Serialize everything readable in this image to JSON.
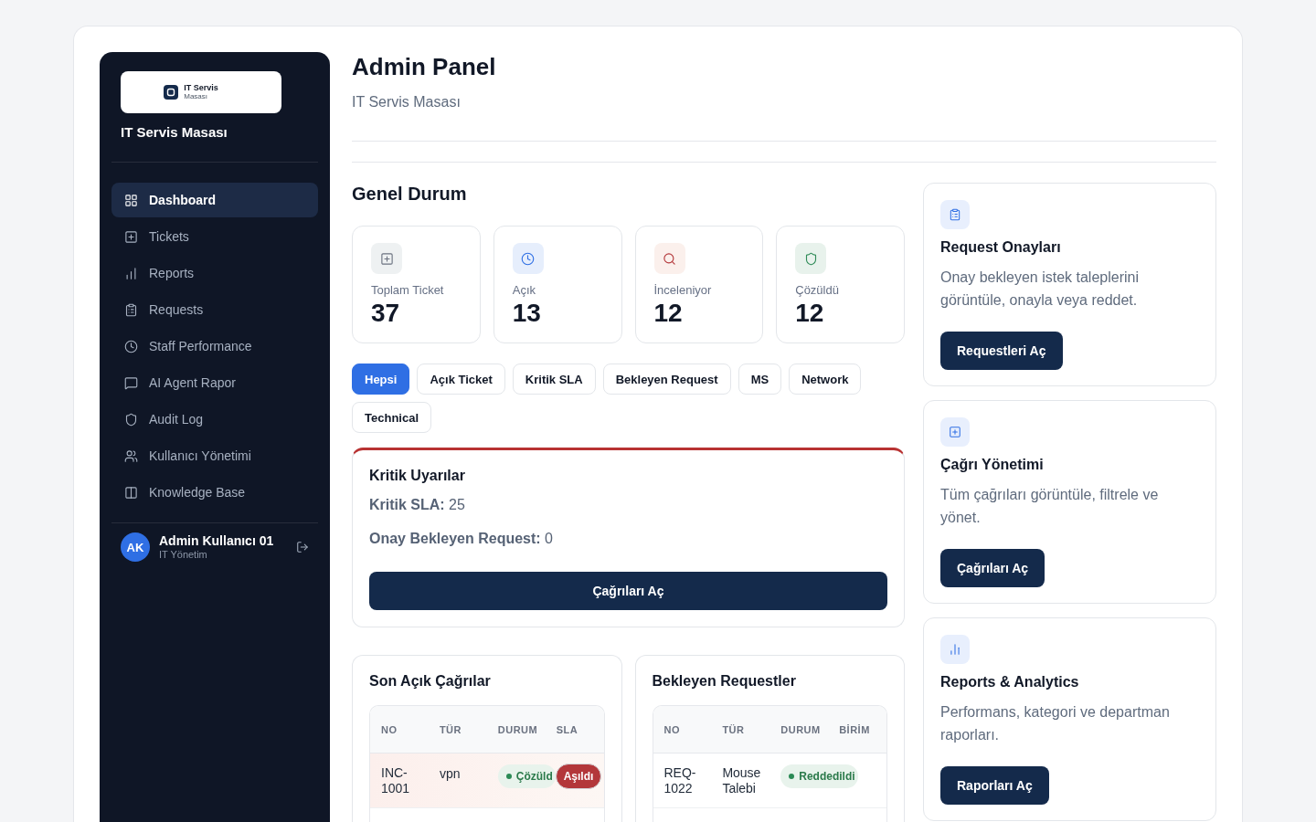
{
  "sidebar": {
    "logo": {
      "title": "IT Servis",
      "subtitle": "Masası"
    },
    "brand": "IT Servis Masası",
    "nav": [
      {
        "label": "Dashboard",
        "selected": true
      },
      {
        "label": "Tickets",
        "selected": false
      },
      {
        "label": "Reports",
        "selected": false
      },
      {
        "label": "Requests",
        "selected": false
      },
      {
        "label": "Staff Performance",
        "selected": false
      },
      {
        "label": "AI Agent Rapor",
        "selected": false
      },
      {
        "label": "Audit Log",
        "selected": false
      },
      {
        "label": "Kullanıcı Yönetimi",
        "selected": false
      },
      {
        "label": "Knowledge Base",
        "selected": false
      }
    ],
    "user": {
      "initials": "AK",
      "name": "Admin Kullanıcı 01",
      "role": "IT Yönetim"
    }
  },
  "header": {
    "title": "Admin Panel",
    "subtitle": "IT Servis Masası"
  },
  "overview": {
    "title": "Genel Durum",
    "stats": [
      {
        "kind": "total",
        "label": "Toplam Ticket",
        "value": "37"
      },
      {
        "kind": "open",
        "label": "Açık",
        "value": "13"
      },
      {
        "kind": "review",
        "label": "İnceleniyor",
        "value": "12"
      },
      {
        "kind": "resolved",
        "label": "Çözüldü",
        "value": "12"
      }
    ]
  },
  "filters": [
    {
      "label": "Hepsi",
      "selected": true
    },
    {
      "label": "Açık Ticket",
      "selected": false
    },
    {
      "label": "Kritik SLA",
      "selected": false
    },
    {
      "label": "Bekleyen Request",
      "selected": false
    },
    {
      "label": "MS",
      "selected": false
    },
    {
      "label": "Network",
      "selected": false
    },
    {
      "label": "Technical",
      "selected": false
    }
  ],
  "alerts": {
    "title": "Kritik Uyarılar",
    "lines": [
      "**Kritik SLA:** 25",
      "**Onay Bekleyen Request:** 0"
    ],
    "button": "Çağrıları Aç"
  },
  "recent_calls": {
    "title": "Son Açık Çağrılar",
    "columns": [
      "NO",
      "TÜR",
      "DURUM",
      "SLA"
    ],
    "rows": [
      {
        "highlighted": true,
        "cells": [
          {
            "kind": "text",
            "text": "INC-1001"
          },
          {
            "kind": "text",
            "text": "vpn"
          },
          {
            "kind": "status",
            "text": "Çözüld"
          },
          {
            "kind": "badge",
            "text": "Aşıldı"
          }
        ]
      }
    ]
  },
  "pending_requests": {
    "title": "Bekleyen Requestler",
    "columns": [
      "NO",
      "TÜR",
      "DURUM",
      "BİRİM"
    ],
    "rows": [
      {
        "highlighted": false,
        "cells": [
          {
            "kind": "text",
            "text": "REQ-1022"
          },
          {
            "kind": "text",
            "text": "Mouse Talebi"
          },
          {
            "kind": "status",
            "text": "Reddedildi"
          }
        ]
      }
    ]
  },
  "actions": [
    {
      "title": "Request Onayları",
      "description": "Onay bekleyen istek taleplerini görüntüle, onayla veya reddet.",
      "button": "Requestleri Aç"
    },
    {
      "title": "Çağrı Yönetimi",
      "description": "Tüm çağrıları görüntüle, filtrele ve yönet.",
      "button": "Çağrıları Aç"
    },
    {
      "title": "Reports & Analytics",
      "description": "Performans, kategori ve departman raporları.",
      "button": "Raporları Aç"
    }
  ]
}
